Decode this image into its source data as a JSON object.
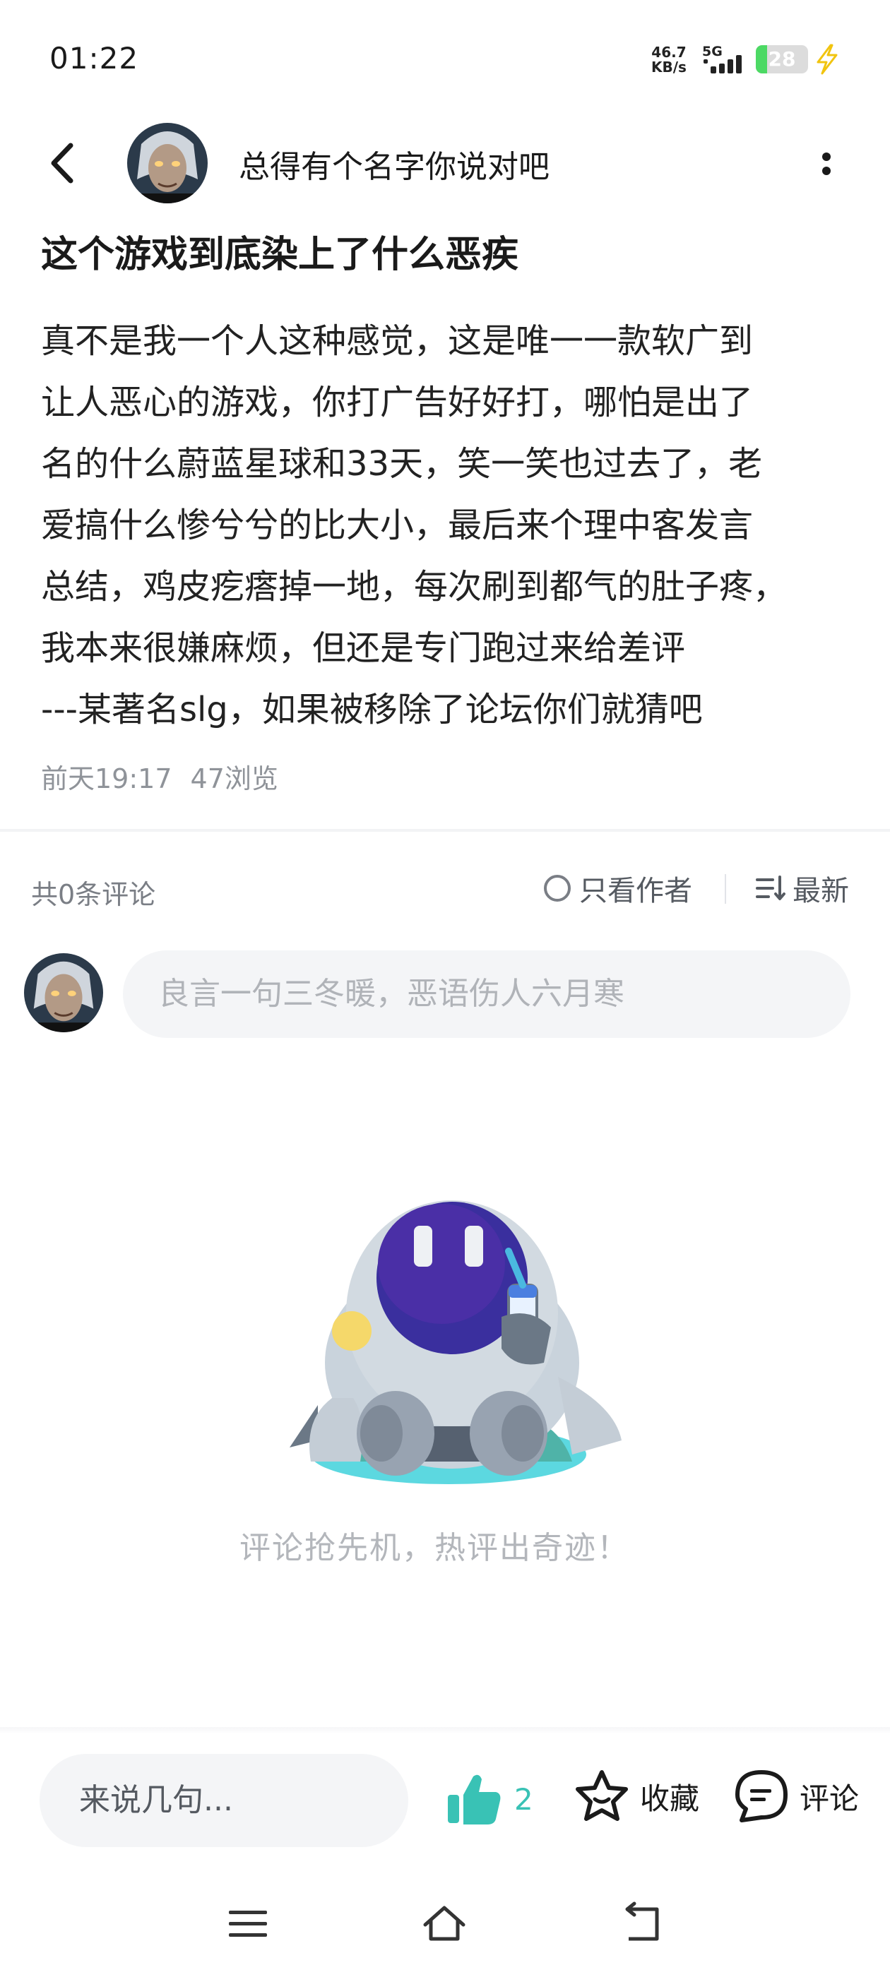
{
  "status_bar": {
    "time": "01:22",
    "net_speed_value": "46.7",
    "net_speed_unit": "KB/s",
    "network_type": "5G",
    "battery_level": "28",
    "charging": true
  },
  "header": {
    "author_name": "总得有个名字你说对吧",
    "back_icon": "chevron-left-icon",
    "more_icon": "more-vertical-icon"
  },
  "post": {
    "title": "这个游戏到底染上了什么恶疾",
    "body": "真不是我一个人这种感觉，这是唯一一款软广到\n让人恶心的游戏，你打广告好好打，哪怕是出了\n名的什么蔚蓝星球和33天，笑一笑也过去了，老\n爱搞什么惨兮兮的比大小，最后来个理中客发言\n总结，鸡皮疙瘩掉一地，每次刷到都气的肚子疼，\n我本来很嫌麻烦，但还是专门跑过来给差评\n---某著名slg，如果被移除了论坛你们就猜吧",
    "time": "前天19:17",
    "views": "47浏览"
  },
  "comments": {
    "count_label": "共0条评论",
    "author_only_label": "只看作者",
    "sort_label": "最新",
    "input_placeholder": "良言一句三冬暖，恶语伤人六月寒",
    "empty_text": "评论抢先机，热评出奇迹！"
  },
  "bottom_bar": {
    "input_placeholder": "来说几句...",
    "like_count": "2",
    "collect_label": "收藏",
    "comment_label": "评论"
  },
  "colors": {
    "accent": "#39c2b5",
    "text_primary": "#1a1a1a",
    "text_muted": "#8f9399",
    "input_bg": "#f4f5f7"
  }
}
